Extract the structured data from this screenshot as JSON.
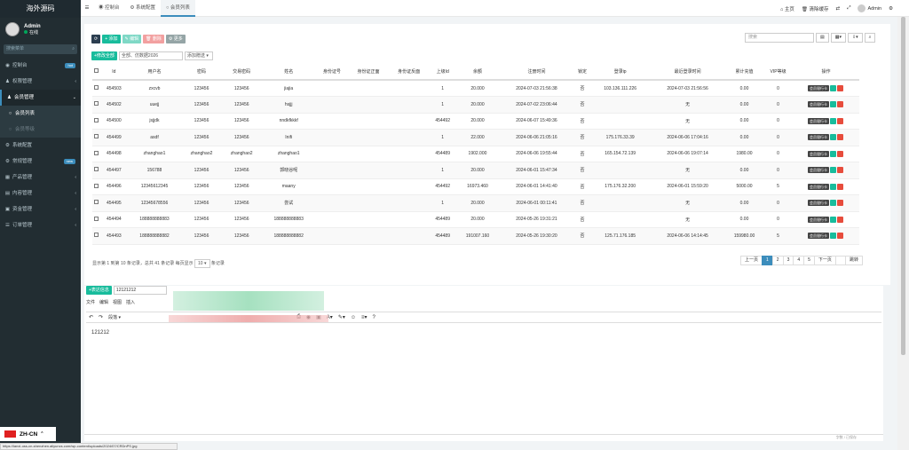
{
  "sidebar": {
    "logo": "海外源码",
    "user_name": "Admin",
    "user_status": "在线",
    "search_placeholder": "搜索菜单",
    "items": [
      {
        "label": "控制台",
        "badge": "hot",
        "badge_color": "#3c8dbc"
      },
      {
        "label": "权限管理"
      },
      {
        "label": "会员管理"
      },
      {
        "label": "会员列表"
      },
      {
        "label": "会员等级"
      },
      {
        "label": "系统配置"
      },
      {
        "label": "常规管理",
        "badge": "new",
        "badge_color": "#3c8dbc"
      },
      {
        "label": "产品管理"
      },
      {
        "label": "内容管理"
      },
      {
        "label": "资金管理"
      },
      {
        "label": "订单管理"
      }
    ]
  },
  "language": "ZH-CN",
  "status_url": "https://lanxi-oss-cn-shenzhen.aliyuncs.com/wp-content/uploads/2024/07/CRDnPS.jpg",
  "topbar": {
    "tabs": [
      "控制台",
      "系统配置",
      "会员列表"
    ],
    "home": "主页",
    "clear_cache": "清除缓存",
    "admin": "Admin"
  },
  "toolbar": {
    "refresh": "⟳",
    "add": "+ 添加",
    "edit": "✎ 编辑",
    "delete": "🗑 删除",
    "more": "⚙ 更多",
    "search_placeholder": "搜索",
    "modify_all": "+修改全部",
    "input_placeholder": "全部、仿数据2026",
    "select_label": "添加赠送"
  },
  "table": {
    "headers": [
      "Id",
      "用户名",
      "密码",
      "交易密码",
      "姓名",
      "身份证号",
      "身份证正面",
      "身份证反面",
      "上级Id",
      "余额",
      "注册时间",
      "锁定",
      "登录ip",
      "最近登录时间",
      "累计充值",
      "VIP等级",
      "操作"
    ],
    "rows": [
      [
        "454503",
        "zxcvb",
        "123456",
        "123456",
        "jiajia",
        "",
        "",
        "",
        "1",
        "20.000",
        "2024-07-03 21:56:38",
        "否",
        "103.136.111.226",
        "2024-07-03 21:56:56",
        "0.00",
        "0"
      ],
      [
        "454502",
        "uuejj",
        "123456",
        "123456",
        "hsjjj",
        "",
        "",
        "",
        "1",
        "20.000",
        "2024-07-02 23:06:44",
        "否",
        "",
        "无",
        "0.00",
        "0"
      ],
      [
        "454500",
        "jsjjdk",
        "123456",
        "123456",
        "nndkfkkkf",
        "",
        "",
        "",
        "454492",
        "20.000",
        "2024-06-07 15:49:36",
        "否",
        "",
        "无",
        "0.00",
        "0"
      ],
      [
        "454499",
        "asdf",
        "123456",
        "123456",
        "Inifi",
        "",
        "",
        "",
        "1",
        "22.000",
        "2024-06-06 21:05:16",
        "否",
        "175.176.33.39",
        "2024-06-06 17:04:16",
        "0.00",
        "0"
      ],
      [
        "454498",
        "zhanghao1",
        "zhanghao2",
        "zhanghao2",
        "zhanghao1",
        "",
        "",
        "",
        "454489",
        "1902.000",
        "2024-06-06 19:55:44",
        "否",
        "165.154.72.139",
        "2024-06-06 19:07:14",
        "1980.00",
        "0"
      ],
      [
        "454497",
        "156788",
        "123456",
        "123456",
        "郭晓谷呢",
        "",
        "",
        "",
        "1",
        "20.000",
        "2024-06-01 15:47:34",
        "否",
        "",
        "无",
        "0.00",
        "0"
      ],
      [
        "454496",
        "12345612345",
        "123456",
        "123456",
        "maany",
        "",
        "",
        "",
        "454492",
        "16973.460",
        "2024-06-01 14:41:40",
        "否",
        "175.176.32.200",
        "2024-06-01 15:59:20",
        "5000.00",
        "5"
      ],
      [
        "454495",
        "12345678556",
        "123456",
        "123456",
        "尝试",
        "",
        "",
        "",
        "1",
        "20.000",
        "2024-06-01 00:11:41",
        "否",
        "",
        "无",
        "0.00",
        "0"
      ],
      [
        "454494",
        "188888888883",
        "123456",
        "123456",
        "188888888883",
        "",
        "",
        "",
        "454489",
        "20.000",
        "2024-05-26 19:31:21",
        "否",
        "",
        "无",
        "0.00",
        "0"
      ],
      [
        "454493",
        "188888888882",
        "123456",
        "123456",
        "188888888882",
        "",
        "",
        "",
        "454489",
        "191007.160",
        "2024-05-26 19:30:20",
        "否",
        "125.71.176.185",
        "2024-06-06 14:14:45",
        "159980.00",
        "5"
      ]
    ],
    "op_label": "会员银行卡"
  },
  "pagination": {
    "info": "显示第 1 到第 10 条记录，总共 41 条记录 每页显示",
    "per_page": "10",
    "suffix": "条记录",
    "prev": "上一页",
    "pages": [
      "1",
      "2",
      "3",
      "4",
      "5"
    ],
    "next": "下一页",
    "go": "跳转"
  },
  "editor": {
    "button": "+表达信息",
    "input_value": "12121212",
    "menu": [
      "文件",
      "编辑",
      "视图",
      "插入"
    ],
    "font": "段落",
    "content": "121212",
    "status": "字数 / 已保存"
  }
}
